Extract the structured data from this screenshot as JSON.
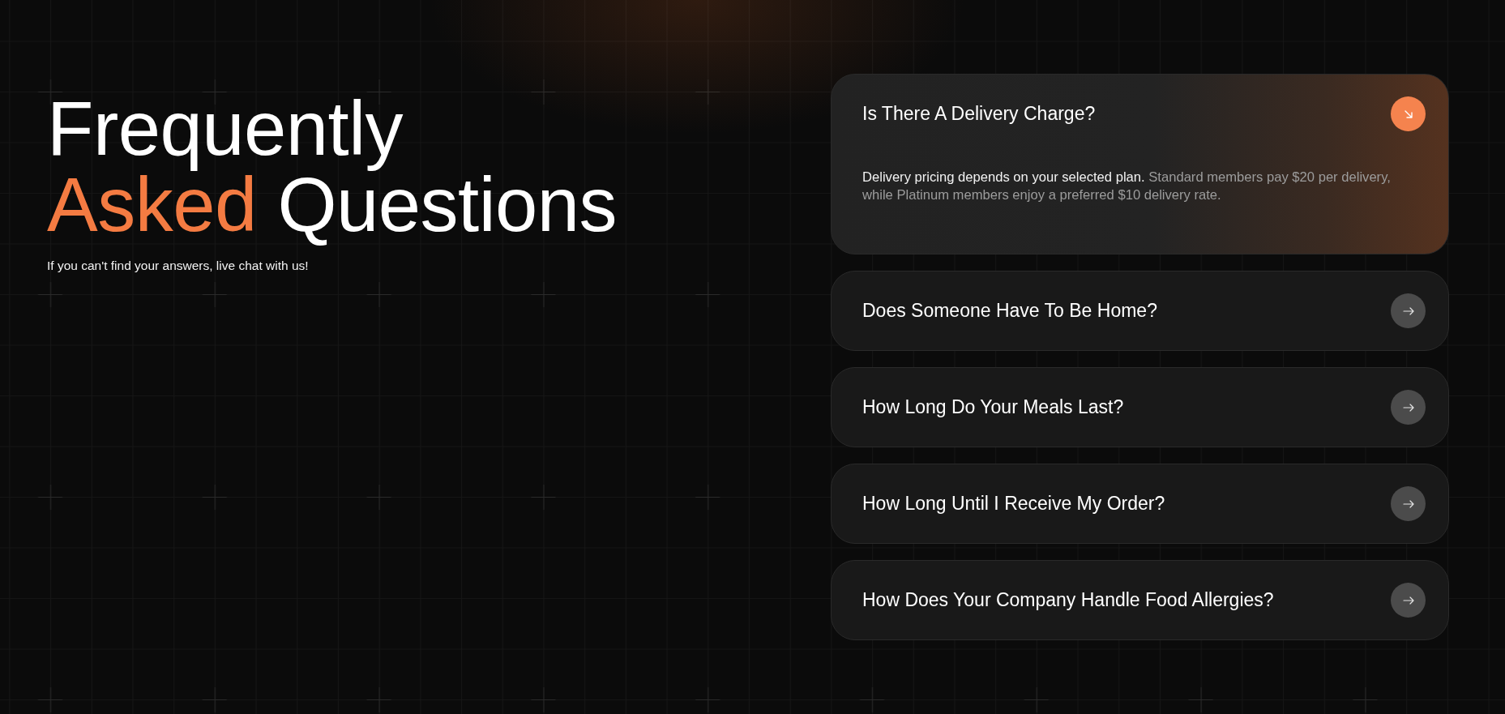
{
  "heading": {
    "lines": [
      [
        {
          "text": "Frequently",
          "highlighted": false
        }
      ],
      [
        {
          "text": "Asked",
          "highlighted": true
        },
        {
          "text": "Questions",
          "highlighted": false
        }
      ]
    ]
  },
  "subtitle": "If you can't find your answers, live chat with us!",
  "faq": {
    "items": [
      {
        "question": "Is There A Delivery Charge?",
        "expanded": true,
        "answer": {
          "lead": "Delivery pricing depends on your selected plan.",
          "rest": "Standard members pay $20 per delivery, while Platinum members enjoy a preferred $10 delivery rate."
        }
      },
      {
        "question": "Does Someone Have To Be Home?",
        "expanded": false
      },
      {
        "question": "How Long Do Your Meals Last?",
        "expanded": false
      },
      {
        "question": "How Long Until I Receive My Order?",
        "expanded": false
      },
      {
        "question": "How Does Your Company Handle Food Allergies?",
        "expanded": false
      }
    ]
  }
}
